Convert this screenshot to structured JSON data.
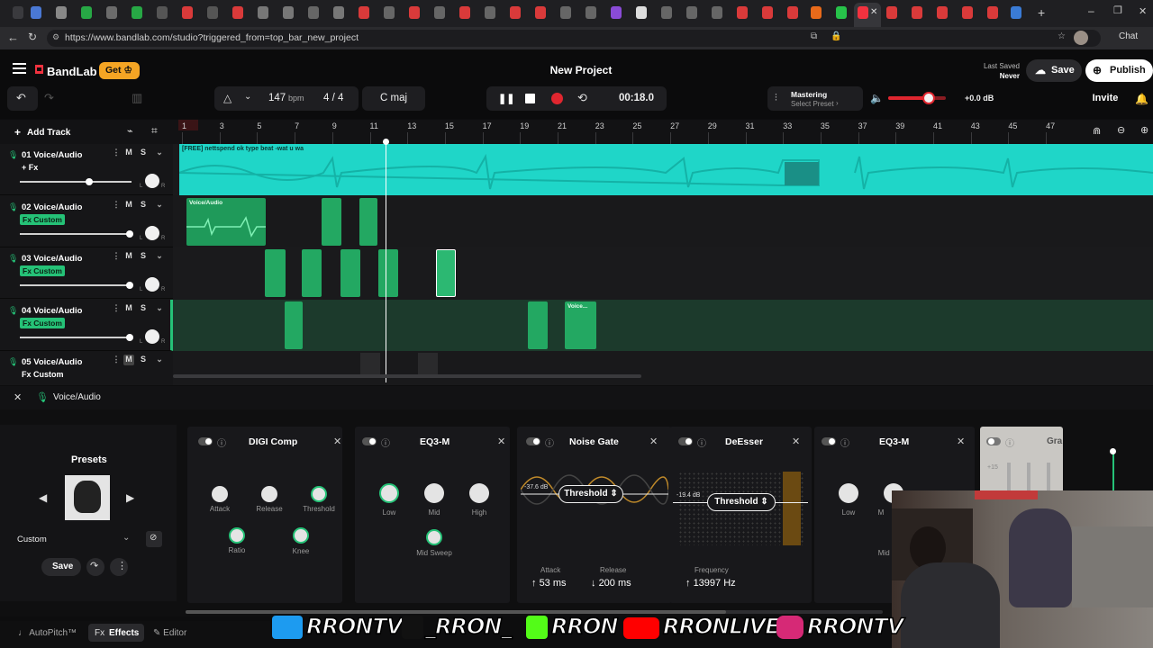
{
  "browser": {
    "url": "https://www.bandlab.com/studio?triggered_from=top_bar_new_project",
    "chat_label": "Chat"
  },
  "header": {
    "logo": "BandLab",
    "get_label": "Get",
    "project_title": "New Project",
    "last_saved_label": "Last Saved",
    "last_saved_value": "Never",
    "save_label": "Save",
    "publish_label": "Publish"
  },
  "transport": {
    "bpm": "147",
    "bpm_unit": "bpm",
    "time_signature": "4 / 4",
    "key": "C maj",
    "time": "00:18.0",
    "mastering_label": "Mastering",
    "mastering_preset": "Select Preset",
    "volume_db": "+0.0 dB",
    "invite_label": "Invite",
    "volume_level": 0.7
  },
  "tracks": {
    "add_track": "Add Track",
    "items": [
      {
        "name": "01  Voice/Audio",
        "fx": "+ Fx",
        "fx_type": "plain",
        "volume": 0.62
      },
      {
        "name": "02  Voice/Audio",
        "fx": "Fx Custom",
        "fx_type": "badge",
        "volume": 0.98
      },
      {
        "name": "03  Voice/Audio",
        "fx": "Fx Custom",
        "fx_type": "badge",
        "volume": 0.98
      },
      {
        "name": "04  Voice/Audio",
        "fx": "Fx Custom",
        "fx_type": "badge",
        "volume": 0.98
      },
      {
        "name": "05  Voice/Audio",
        "fx": "Fx Custom",
        "fx_type": "plain",
        "volume": 0.98
      }
    ]
  },
  "ruler": {
    "numbers": [
      "1",
      "3",
      "5",
      "7",
      "9",
      "11",
      "13",
      "15",
      "17",
      "19",
      "21",
      "23",
      "25",
      "27",
      "29",
      "31",
      "33",
      "35",
      "37",
      "39",
      "41",
      "43",
      "45",
      "47"
    ]
  },
  "clips": {
    "beat_label": "[FREE] nettspend  ok type beat -wat u wa",
    "voice_label": "Voice/Audio",
    "voice_short": "Voice..."
  },
  "effects_header": {
    "title": "Voice/Audio"
  },
  "presets": {
    "title": "Presets",
    "selected": "Custom",
    "save_label": "Save"
  },
  "effects": [
    {
      "title": "DIGI Comp",
      "knobs": [
        "Attack",
        "Release",
        "Threshold",
        "Ratio",
        "Knee"
      ]
    },
    {
      "title": "EQ3-M",
      "knobs": [
        "Low",
        "Mid",
        "High",
        "Mid Sweep"
      ]
    },
    {
      "title": "Noise Gate",
      "threshold_db": "-37.6 dB",
      "threshold_label": "Threshold",
      "attack_label": "Attack",
      "attack_value": "53 ms",
      "release_label": "Release",
      "release_value": "200 ms"
    },
    {
      "title": "DeEsser",
      "threshold_db": "-19.4 dB",
      "threshold_label": "Threshold",
      "frequency_label": "Frequency",
      "frequency_value": "13997 Hz"
    },
    {
      "title": "EQ3-M",
      "knobs": [
        "Low",
        "M",
        "Mid S"
      ]
    },
    {
      "title": "Gra",
      "scale_value": "+15"
    }
  ],
  "bottom_tabs": {
    "autopitch": "AutoPitch™",
    "effects": "Effects",
    "editor": "Editor",
    "effects_prefix": "Fx"
  },
  "overlay": {
    "twitter": "RRONTV",
    "tiktok": "_RRON_",
    "kick": "RRON",
    "youtube": "RRONLIVE",
    "instagram": "RRONTV"
  },
  "colors": {
    "accent": "#25c277",
    "clip_green": "#1f9a5a",
    "beat_cyan": "#1fd6c8",
    "brand_red": "#f2323f",
    "get_orange": "#f5a524",
    "record_red": "#e0262f"
  }
}
